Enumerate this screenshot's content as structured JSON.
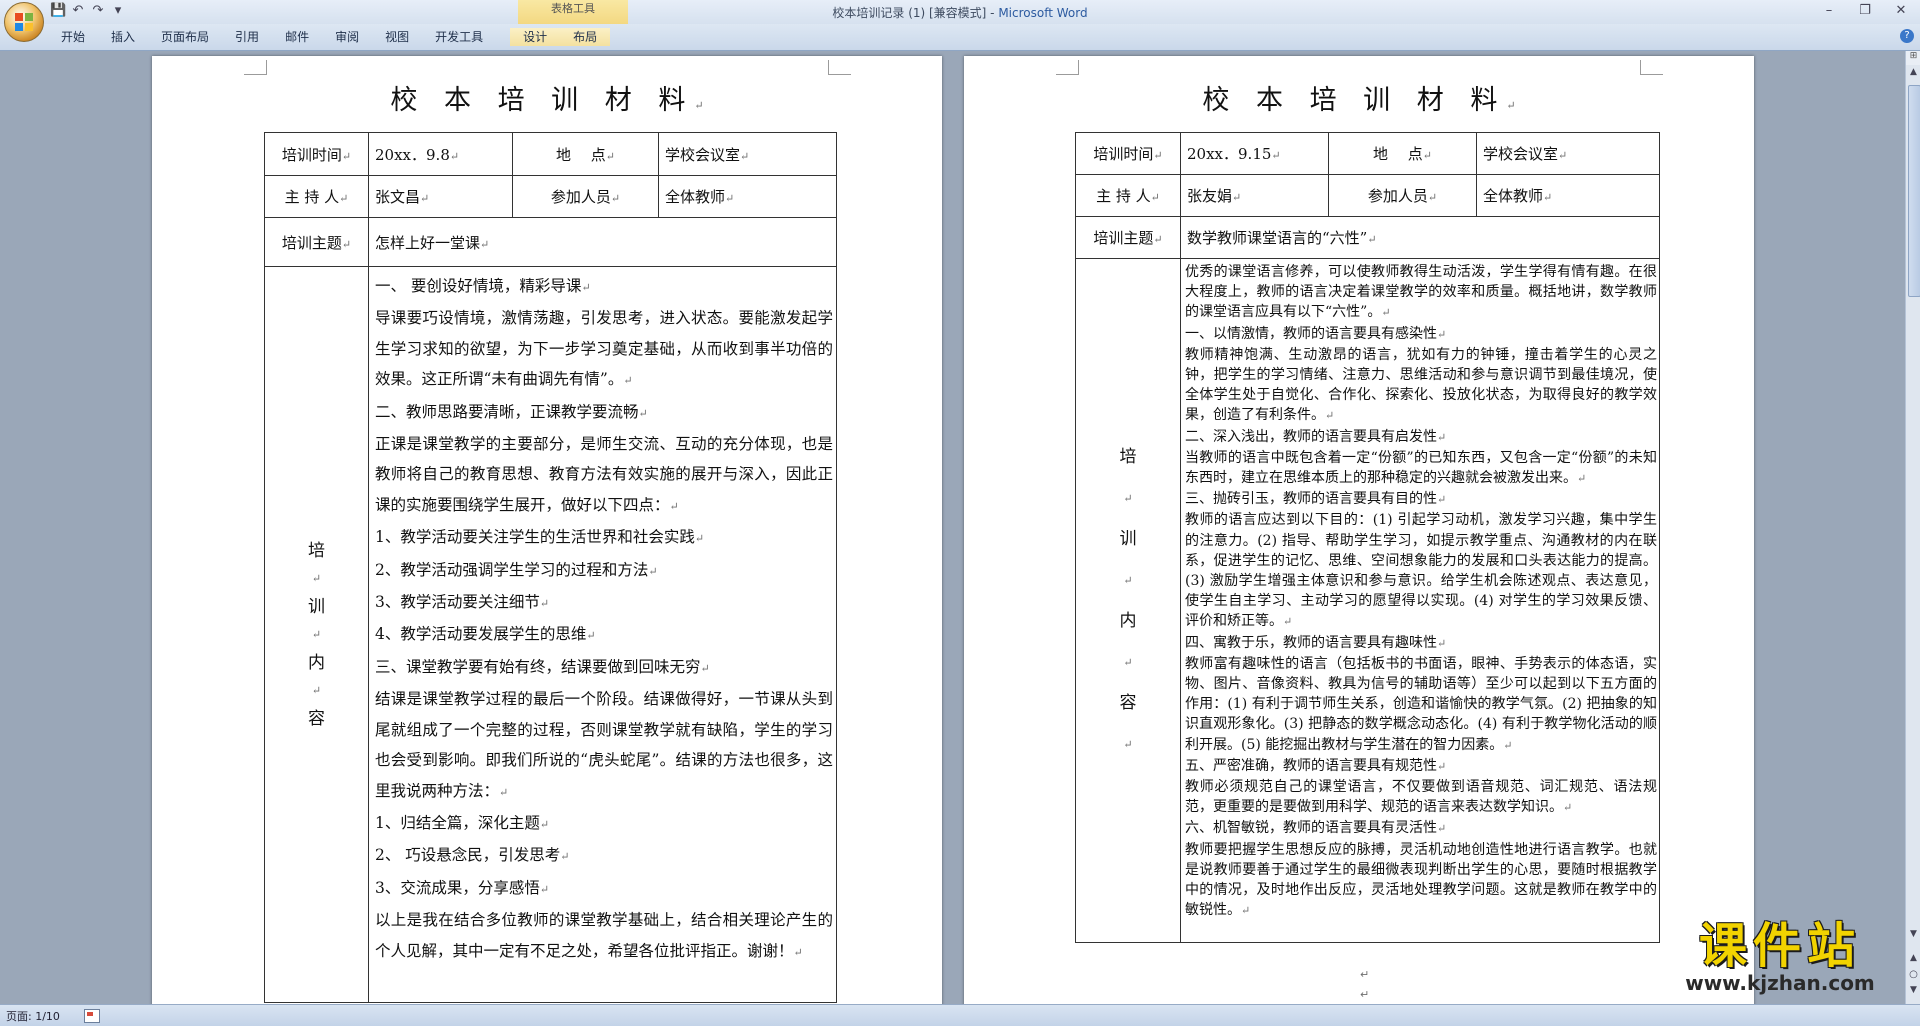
{
  "window": {
    "title": "校本培训记录 (1) [兼容模式] - ",
    "app_name": "Microsoft Word",
    "context_tab_group": "表格工具",
    "qat": [
      "save-icon",
      "undo-icon",
      "redo-icon",
      "customize-icon"
    ],
    "controls": {
      "minimize": "–",
      "restore": "❐",
      "close": "✕"
    }
  },
  "ribbon": {
    "tabs": [
      "开始",
      "插入",
      "页面布局",
      "引用",
      "邮件",
      "审阅",
      "视图",
      "开发工具",
      "设计",
      "布局"
    ],
    "help": "?"
  },
  "mark": "↵",
  "page1": {
    "title": "校 本 培 训 材 料",
    "row1": {
      "l1": "培训时间",
      "v1": "20xx．9.8",
      "l2": "地　 点",
      "v2": "学校会议室"
    },
    "row2": {
      "l1": "主 持 人",
      "v1": "张文昌",
      "l2": "参加人员",
      "v2": "全体教师"
    },
    "row3": {
      "l1": "培训主题",
      "v1": "怎样上好一堂课"
    },
    "content_label": [
      "培",
      "训",
      "内",
      "容"
    ],
    "content": [
      "一、 要创设好情境，精彩导课",
      "导课要巧设情境，激情荡趣，引发思考，进入状态。要能激发起学生学习求知的欲望，为下一步学习奠定基础，从而收到事半功倍的效果。这正所谓“未有曲调先有情”。",
      "二、教师思路要清晰，正课教学要流畅",
      "正课是课堂教学的主要部分，是师生交流、互动的充分体现，也是教师将自己的教育思想、教育方法有效实施的展开与深入，因此正课的实施要围绕学生展开，做好以下四点：",
      "1、教学活动要关注学生的生活世界和社会实践",
      "2、教学活动强调学生学习的过程和方法",
      "3、教学活动要关注细节",
      "4、教学活动要发展学生的思维",
      "三、课堂教学要有始有终，结课要做到回味无穷",
      "结课是课堂教学过程的最后一个阶段。结课做得好，一节课从头到尾就组成了一个完整的过程，否则课堂教学就有缺陷，学生的学习也会受到影响。即我们所说的“虎头蛇尾”。结课的方法也很多，这里我说两种方法：",
      "1、归结全篇，深化主题",
      "2、 巧设悬念民，引发思考",
      "3、交流成果，分享感悟",
      "以上是我在结合多位教师的课堂教学基础上，结合相关理论产生的个人见解，其中一定有不足之处，希望各位批评指正。谢谢！"
    ]
  },
  "page2": {
    "title": "校 本 培 训 材 料",
    "row1": {
      "l1": "培训时间",
      "v1": "20xx．9.15",
      "l2": "地　 点",
      "v2": "学校会议室"
    },
    "row2": {
      "l1": "主 持 人",
      "v1": "张友娟",
      "l2": "参加人员",
      "v2": "全体教师"
    },
    "row3": {
      "l1": "培训主题",
      "v1": "数学教师课堂语言的“六性”"
    },
    "content_label": [
      "培",
      "训",
      "内",
      "容"
    ],
    "content": [
      "优秀的课堂语言修养，可以使教师教得生动活泼，学生学得有情有趣。在很大程度上，教师的语言决定着课堂教学的效率和质量。概括地讲，数学教师的课堂语言应具有以下“六性”。",
      "一、以情激情，教师的语言要具有感染性",
      "教师精神饱满、生动激昂的语言，犹如有力的钟锤，撞击着学生的心灵之钟，把学生的学习情绪、注意力、思维活动和参与意识调节到最佳境况，使全体学生处于自觉化、合作化、探索化、投放化状态，为取得良好的教学效果，创造了有利条件。",
      "二、深入浅出，教师的语言要具有启发性",
      "当教师的语言中既包含着一定“份额”的已知东西，又包含一定“份额”的未知东西时，建立在思维本质上的那种稳定的兴趣就会被激发出来。",
      "三、抛砖引玉，教师的语言要具有目的性",
      "教师的语言应达到以下目的：(1) 引起学习动机，激发学习兴趣，集中学生的注意力。(2) 指导、帮助学生学习，如提示教学重点、沟通教材的内在联系，促进学生的记忆、思维、空间想象能力的发展和口头表达能力的提高。(3) 激励学生增强主体意识和参与意识。给学生机会陈述观点、表达意见，使学生自主学习、主动学习的愿望得以实现。(4) 对学生的学习效果反馈、评价和矫正等。",
      "四、寓教于乐，教师的语言要具有趣味性",
      "教师富有趣味性的语言（包括板书的书面语，眼神、手势表示的体态语，实物、图片、音像资料、教具为信号的辅助语等）至少可以起到以下五方面的作用：(1) 有利于调节师生关系，创造和谐愉快的教学气氛。(2) 把抽象的知识直观形象化。(3) 把静态的数学概念动态化。(4) 有利于教学物化活动的顺利开展。(5) 能挖掘出教材与学生潜在的智力因素。",
      "五、严密准确，教师的语言要具有规范性",
      "教师必须规范自己的课堂语言，不仅要做到语音规范、词汇规范、语法规范，更重要的是要做到用科学、规范的语言来表达数学知识。",
      "六、机智敏锐，教师的语言要具有灵活性",
      "教师要把握学生思想反应的脉搏，灵活机动地创造性地进行语言教学。也就是说教师要善于通过学生的最细微表现判断出学生的心思，要随时根据教学中的情况，及时地作出反应，灵活地处理教学问题。这就是教师在教学中的敏锐性。"
    ]
  },
  "status": {
    "page": "页面: 1/10"
  },
  "watermark": {
    "text": "课件站",
    "url": "www.kjzhan.com"
  },
  "scrollbar": {
    "ruler": "⊞",
    "up": "▲",
    "down": "▼",
    "prev": "▲",
    "browse": "○",
    "next": "▼"
  }
}
